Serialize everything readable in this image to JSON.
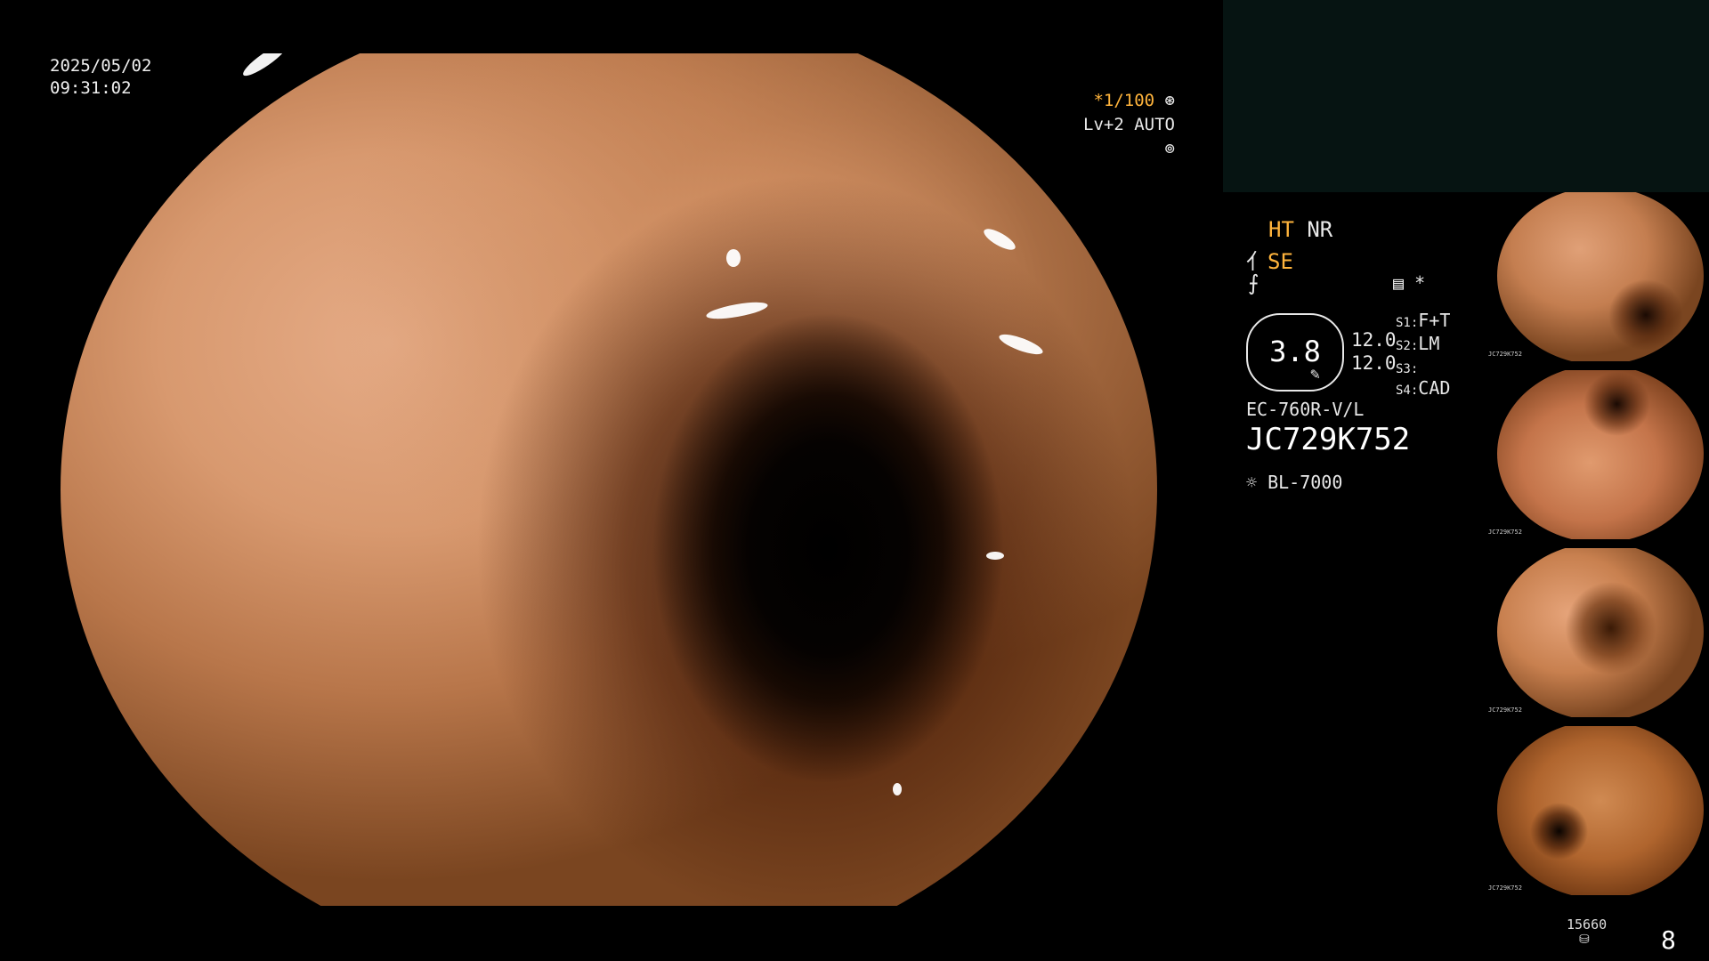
{
  "overlay": {
    "date": "2025/05/02",
    "time": "09:31:02",
    "shutter": "*1/100",
    "iris": "Lv+2 AUTO"
  },
  "info": {
    "ht": "HT",
    "nr": "NR",
    "se": "SE",
    "scope_value": "3.8",
    "value_top": "12.0",
    "value_bottom": "12.0",
    "s1_label": "S1:",
    "s1_value": "F+T",
    "s2_label": "S2:",
    "s2_value": "LM",
    "s3_label": "S3:",
    "s3_value": "",
    "s4_label": "S4:",
    "s4_value": "CAD",
    "scope_model": "EC-760R-V/L",
    "serial": "JC729K752",
    "light_source": "BL-7000",
    "asterisk": "*"
  },
  "thumbnails": [
    {
      "label": "JC729K752"
    },
    {
      "label": "JC729K752"
    },
    {
      "label": "JC729K752"
    },
    {
      "label": "JC729K752"
    }
  ],
  "storage": {
    "count": "15660",
    "page": "8"
  },
  "colors": {
    "accent_orange": "#ffb43c",
    "panel_dark": "#061412"
  }
}
